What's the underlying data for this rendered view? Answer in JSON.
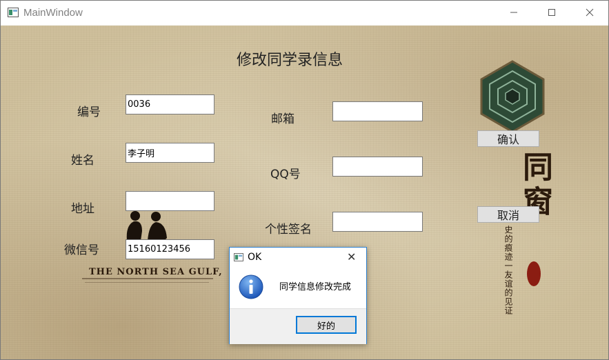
{
  "window": {
    "title": "MainWindow"
  },
  "form": {
    "heading": "修改同学录信息",
    "fields": {
      "id": {
        "label": "编号",
        "value": "0036"
      },
      "name": {
        "label": "姓名",
        "value": "李子明"
      },
      "address": {
        "label": "地址",
        "value": ""
      },
      "wechat": {
        "label": "微信号",
        "value": "15160123456"
      },
      "email": {
        "label": "邮箱",
        "value": ""
      },
      "qq": {
        "label": "QQ号",
        "value": ""
      },
      "signature": {
        "label": "个性签名",
        "value": ""
      }
    },
    "buttons": {
      "confirm": "确认",
      "cancel": "取消"
    }
  },
  "background": {
    "banner_title": "THE NORTH SEA GULF,",
    "big_chars": "同窗",
    "vertical_text": "史的痕迹一友谊的见证"
  },
  "dialog": {
    "title": "OK",
    "message": "同学信息修改完成",
    "ok_label": "好的",
    "icon": "info-icon",
    "accent": "#0078d7"
  }
}
